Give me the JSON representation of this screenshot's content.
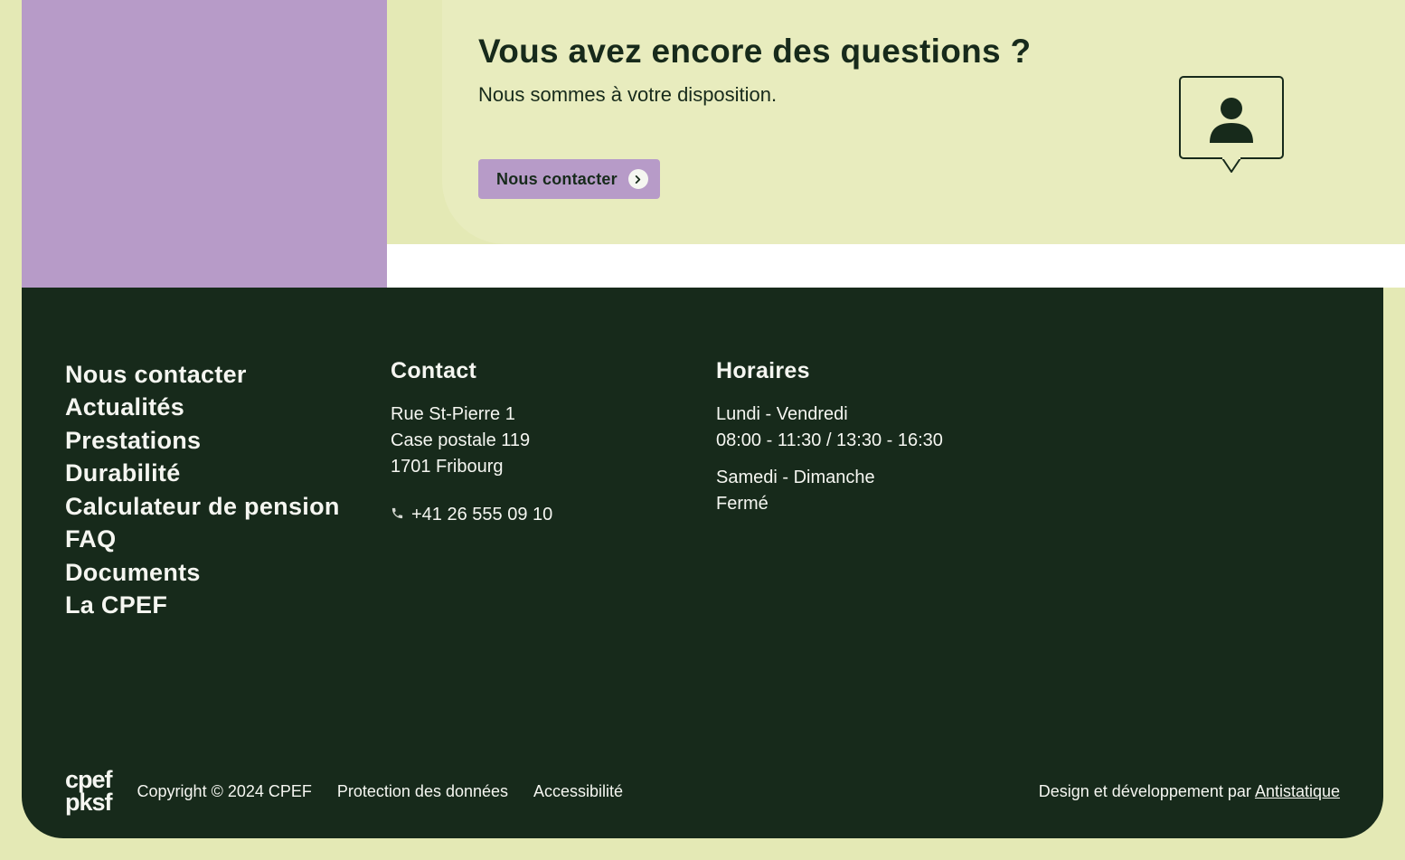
{
  "cta": {
    "heading": "Vous avez encore des questions ?",
    "sub": "Nous sommes à votre disposition.",
    "button": "Nous contacter"
  },
  "footer": {
    "nav": [
      "Nous contacter",
      "Actualités",
      "Prestations",
      "Durabilité",
      "Calculateur de pension",
      "FAQ",
      "Documents",
      "La CPEF"
    ],
    "contact": {
      "title": "Contact",
      "address": {
        "line1": "Rue St-Pierre 1",
        "line2": "Case postale 119",
        "line3": "1701 Fribourg"
      },
      "phone": "+41 26 555 09 10"
    },
    "hours": {
      "title": "Horaires",
      "week": {
        "days": "Lundi - Vendredi",
        "time": "08:00 - 11:30 / 13:30 - 16:30"
      },
      "weekend": {
        "days": "Samedi - Dimanche",
        "time": "Fermé"
      }
    },
    "bar": {
      "logo_line1": "cpef",
      "logo_line2": "pksf",
      "copyright": "Copyright © 2024 CPEF",
      "privacy": "Protection des données",
      "accessibility": "Accessibilité",
      "credit_text": "Design et développement par ",
      "credit_link": "Antistatique"
    }
  }
}
